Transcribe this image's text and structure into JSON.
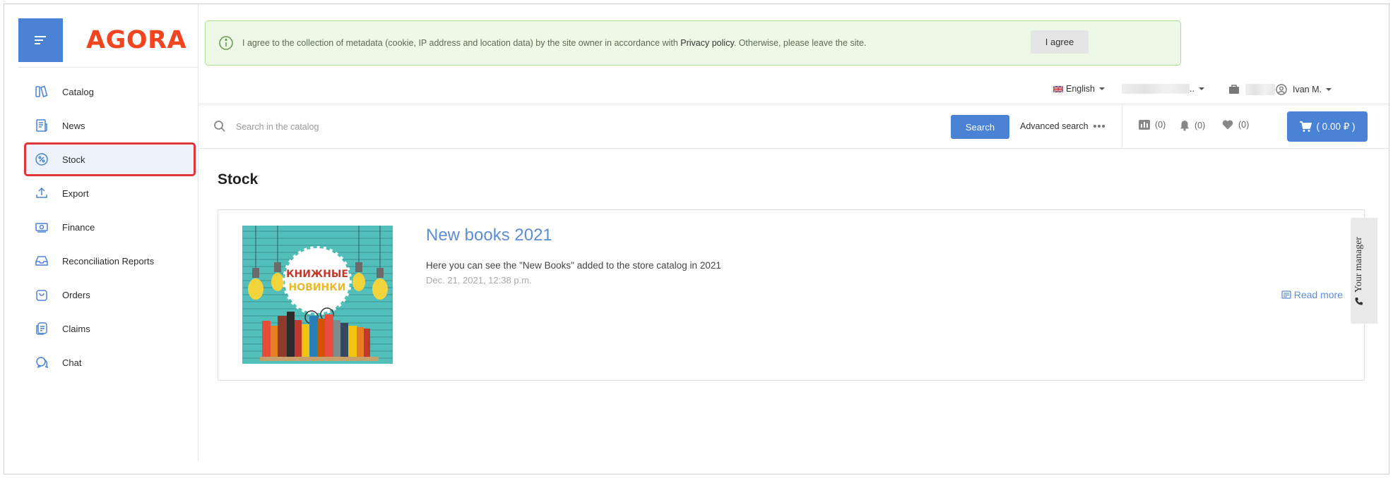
{
  "brand": {
    "logo_text": "AGORA",
    "accent": "#4a82d6",
    "logo_color": "#f0451f"
  },
  "sidebar": {
    "items": [
      {
        "label": "Catalog",
        "icon": "catalog-icon"
      },
      {
        "label": "News",
        "icon": "news-icon"
      },
      {
        "label": "Stock",
        "icon": "percent-icon",
        "active": true
      },
      {
        "label": "Export",
        "icon": "upload-icon"
      },
      {
        "label": "Finance",
        "icon": "banknote-icon"
      },
      {
        "label": "Reconciliation Reports",
        "icon": "inbox-icon"
      },
      {
        "label": "Orders",
        "icon": "shopping-bag-icon"
      },
      {
        "label": "Claims",
        "icon": "claims-icon"
      },
      {
        "label": "Chat",
        "icon": "chat-icon"
      }
    ]
  },
  "consent": {
    "text_before": "I agree to the collection of metadata (cookie, IP address and location data) by the site owner in accordance with ",
    "link": "Privacy policy",
    "text_after": ". Otherwise, please leave the site.",
    "button": "I agree"
  },
  "topbar": {
    "language": "English",
    "company_suffix": "..",
    "user": "Ivan M."
  },
  "search": {
    "placeholder": "Search in the catalog",
    "button": "Search",
    "advanced": "Advanced search"
  },
  "counters": {
    "compare": "(0)",
    "notifications": "(0)",
    "favorites": "(0)"
  },
  "cart": {
    "label": "( 0.00 ₽ )"
  },
  "page": {
    "title": "Stock"
  },
  "promo": {
    "title": "New books 2021",
    "description": "Here you can see the \"New Books\" added to the store catalog in 2021",
    "date": "Dec. 21, 2021, 12:38 p.m.",
    "read_more": "Read more",
    "image_line1": "КНИЖНЫЕ",
    "image_line2": "НОВИНКИ"
  },
  "manager_tab": {
    "label": "Your manager"
  }
}
